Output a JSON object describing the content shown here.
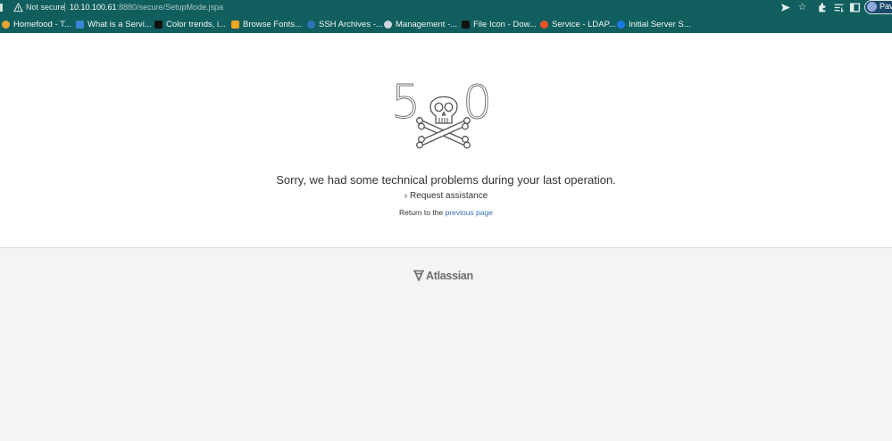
{
  "browser": {
    "security_label": "Not secure",
    "url_host": "10.10.100.61",
    "url_path": ":8880/secure/SetupMode.jspa",
    "profile_name": "Pav",
    "bookmarks": [
      {
        "label": "Homefood - T...",
        "icon": "homefood-icon",
        "color": "#e8a531"
      },
      {
        "label": "What is a Servi...",
        "icon": "blue-bars-icon",
        "color": "#3a86d4"
      },
      {
        "label": "Color trends, i...",
        "icon": "colortrends-icon",
        "color": "#111111"
      },
      {
        "label": "Browse Fonts...",
        "icon": "fonts-icon",
        "color": "#f5a623"
      },
      {
        "label": "SSH Archives -...",
        "icon": "wordpress-icon",
        "color": "#2b76b9"
      },
      {
        "label": "Management -...",
        "icon": "management-icon",
        "color": "#cfd6e0"
      },
      {
        "label": "File Icon - Dow...",
        "icon": "fileicon-icon",
        "color": "#111111"
      },
      {
        "label": "Service - LDAP...",
        "icon": "ubuntu-icon",
        "color": "#e95420"
      },
      {
        "label": "Initial Server S...",
        "icon": "digitalocean-icon",
        "color": "#1a7ae0"
      }
    ]
  },
  "page": {
    "error_code_left": "5",
    "error_code_right": "0",
    "message": "Sorry, we had some technical problems during your last operation.",
    "request_assistance": "Request assistance",
    "return_prefix": "Return to the",
    "return_link": "previous page",
    "footer_brand": "Atlassian"
  }
}
